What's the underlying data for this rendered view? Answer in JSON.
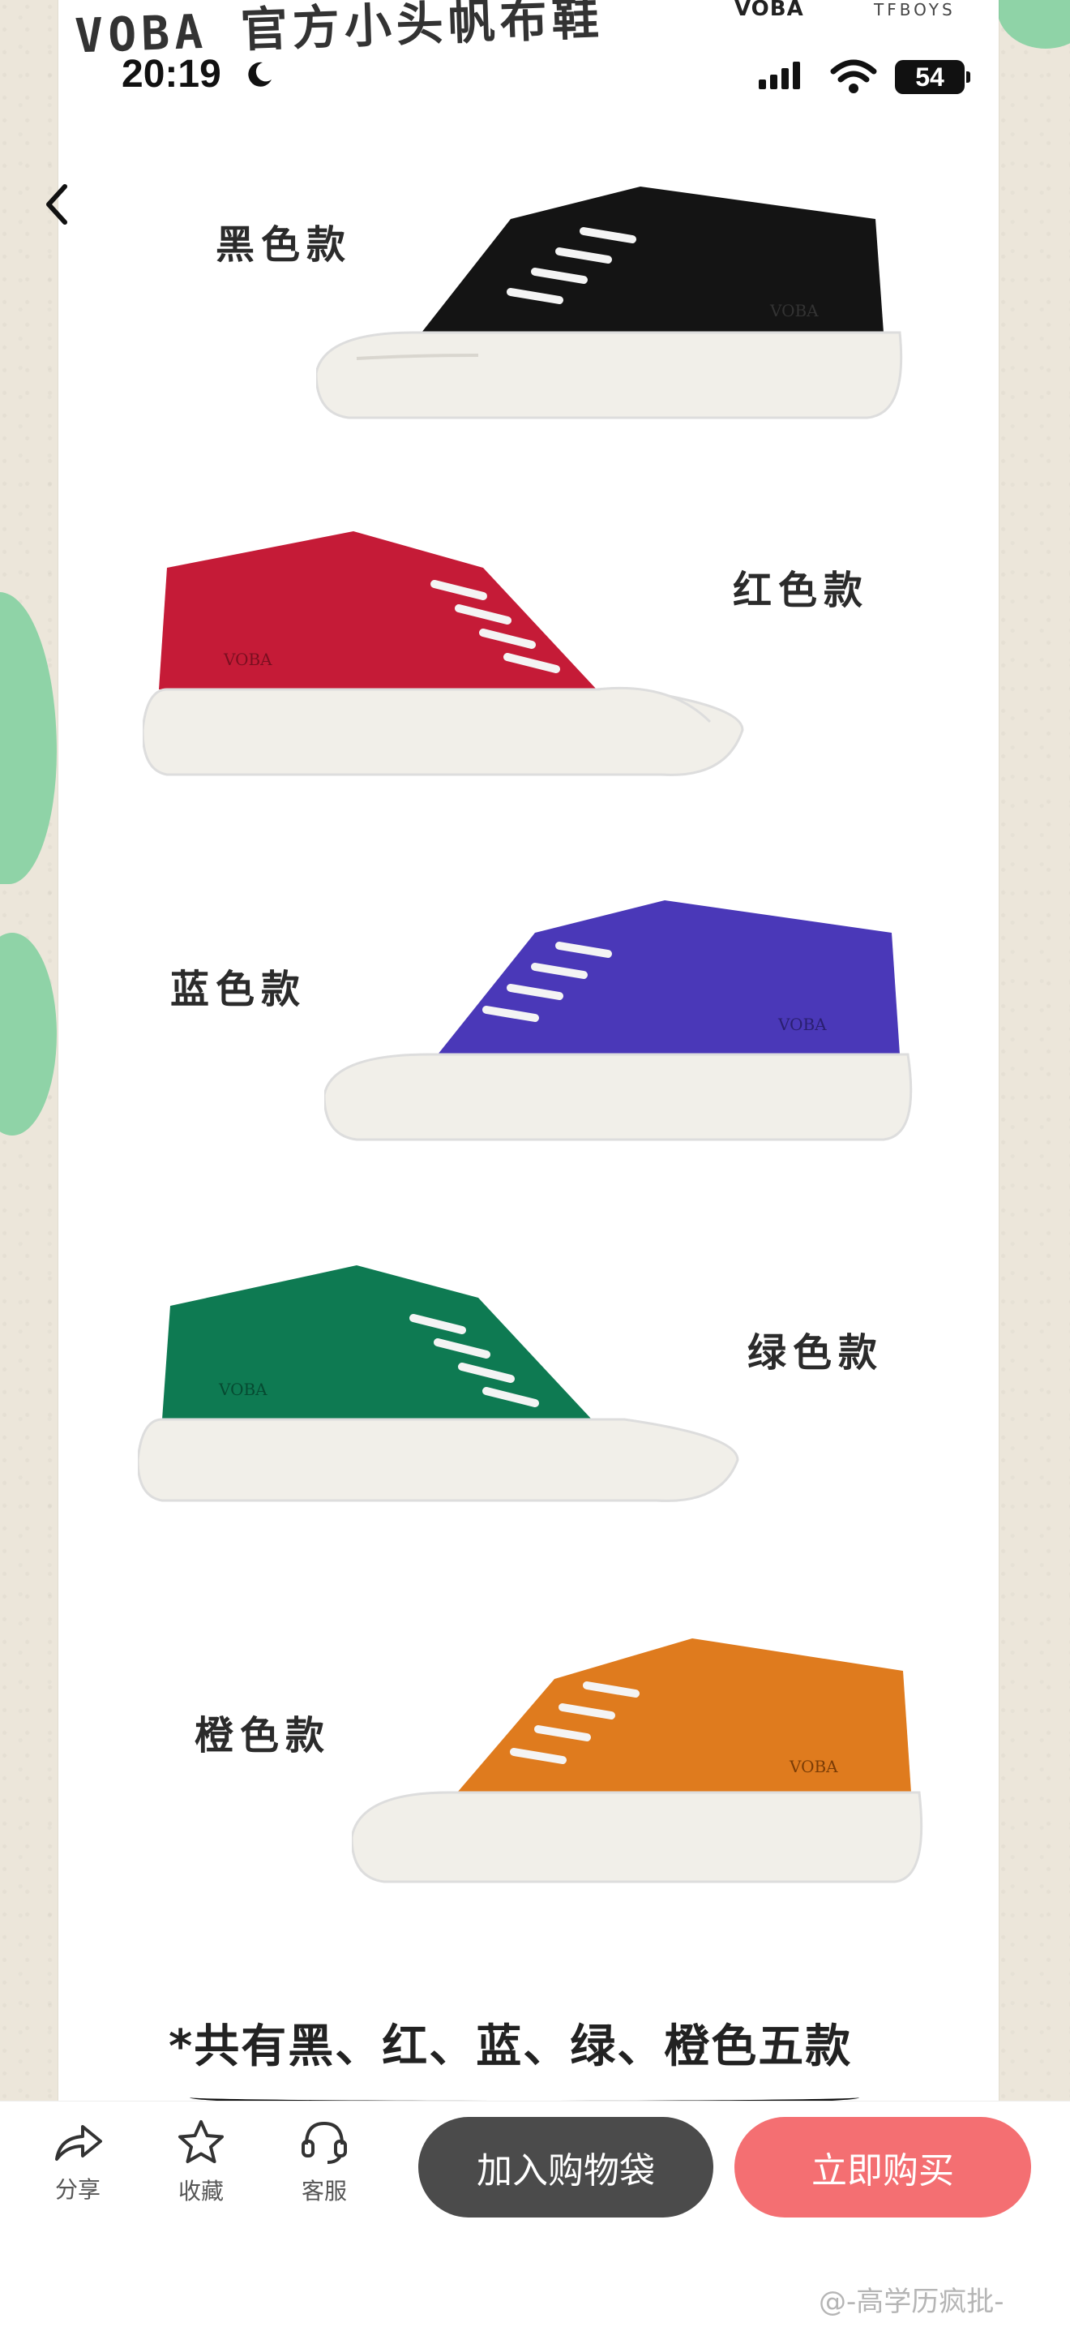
{
  "header": {
    "title": "VOBA 官方小头帆布鞋",
    "brand_left": "VOBA",
    "brand_right": "TFBOYS"
  },
  "status_bar": {
    "time": "20:19",
    "battery": "54"
  },
  "products": [
    {
      "label": "黑色款",
      "color": "#141414"
    },
    {
      "label": "红色款",
      "color": "#c51b37"
    },
    {
      "label": "蓝色款",
      "color": "#4a38b8"
    },
    {
      "label": "绿色款",
      "color": "#0e7a52"
    },
    {
      "label": "橙色款",
      "color": "#df7b1e"
    }
  ],
  "shoe_brand_mark": "VOBA",
  "footnote": "*共有黑、红、蓝、绿、橙色五款",
  "bottom_bar": {
    "share": "分享",
    "favorite": "收藏",
    "service": "客服",
    "add_to_cart": "加入购物袋",
    "buy_now": "立即购买"
  },
  "watermark": "@-高学历疯批-",
  "colors": {
    "accent_buy": "#f46f72",
    "cart_button": "#4b4b4b",
    "side_green": "#8fd3a7"
  }
}
